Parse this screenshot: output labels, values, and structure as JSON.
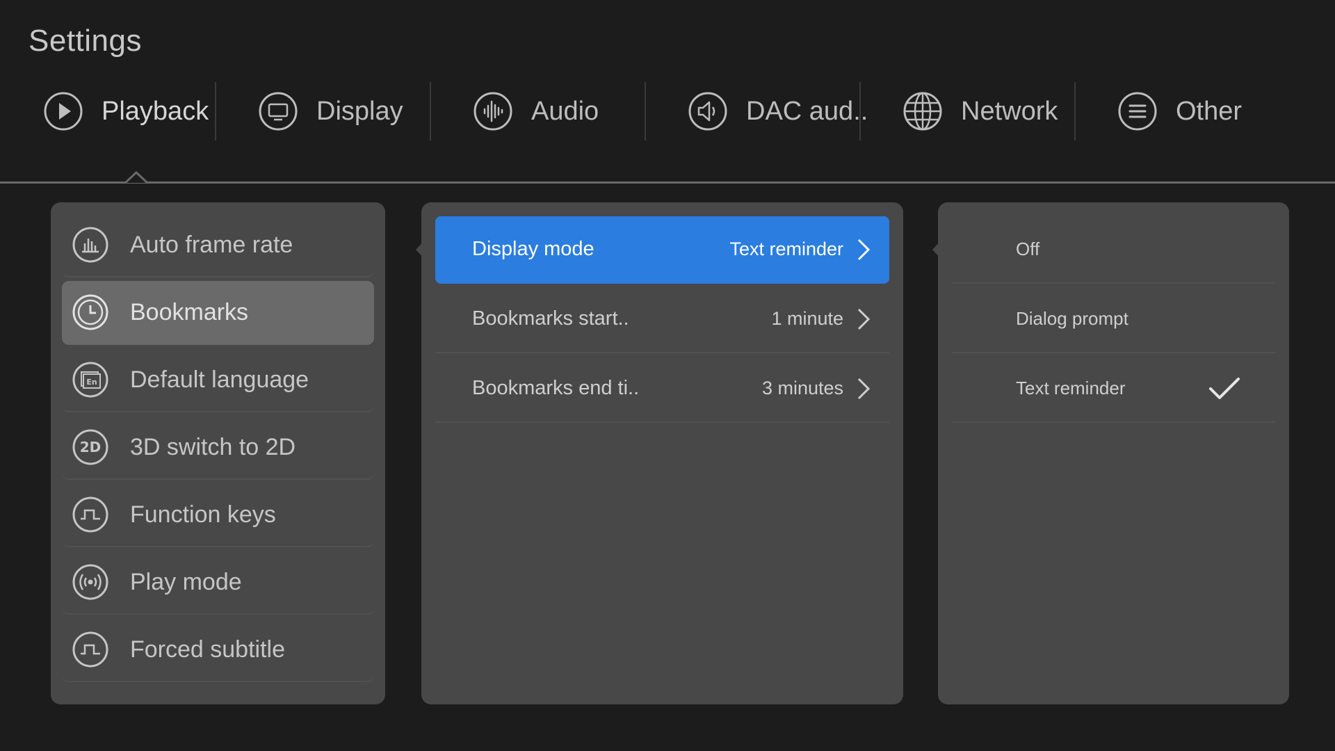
{
  "title": "Settings",
  "tabs": [
    {
      "label": "Playback",
      "icon": "play-circle-icon",
      "active": true
    },
    {
      "label": "Display",
      "icon": "monitor-icon"
    },
    {
      "label": "Audio",
      "icon": "audio-wave-icon"
    },
    {
      "label": "DAC aud..",
      "icon": "speaker-icon"
    },
    {
      "label": "Network",
      "icon": "globe-icon"
    },
    {
      "label": "Other",
      "icon": "menu-lines-icon"
    }
  ],
  "left_menu": [
    {
      "label": "Auto frame rate",
      "icon": "bar-chart-icon"
    },
    {
      "label": "Bookmarks",
      "icon": "clock-icon",
      "selected": true
    },
    {
      "label": "Default language",
      "icon": "language-en-icon"
    },
    {
      "label": "3D switch to 2D",
      "icon": "2d-icon"
    },
    {
      "label": "Function keys",
      "icon": "pulse-wave-icon"
    },
    {
      "label": "Play mode",
      "icon": "broadcast-icon"
    },
    {
      "label": "Forced subtitle",
      "icon": "pulse-wave-icon"
    }
  ],
  "settings": [
    {
      "label": "Display mode",
      "value": "Text reminder",
      "focused": true
    },
    {
      "label": "Bookmarks start..",
      "value": "1 minute"
    },
    {
      "label": "Bookmarks end ti..",
      "value": "3 minutes"
    }
  ],
  "options": [
    {
      "label": "Off"
    },
    {
      "label": "Dialog prompt"
    },
    {
      "label": "Text reminder",
      "checked": true
    }
  ],
  "colors": {
    "accent": "#2b7de0",
    "background": "#1c1c1c",
    "panel": "#484848"
  }
}
